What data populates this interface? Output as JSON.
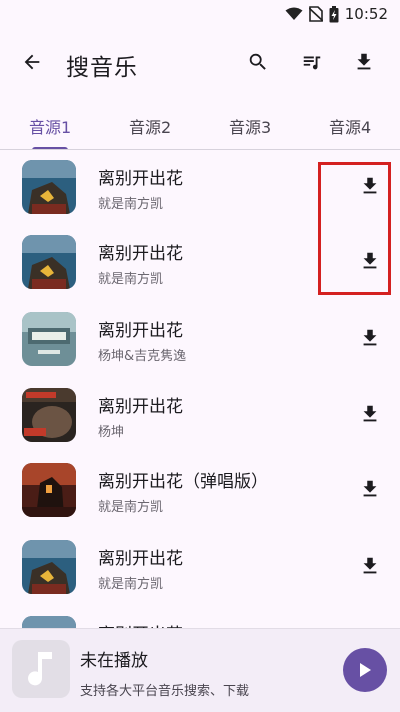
{
  "status_bar": {
    "time": "10:52",
    "icons": [
      "wifi-icon",
      "no-sim-icon",
      "battery-charging-icon"
    ]
  },
  "app_bar": {
    "title": "搜音乐",
    "icons": [
      "back-arrow-icon",
      "search-icon",
      "playlist-icon",
      "download-icon"
    ]
  },
  "tabs": [
    {
      "label": "音源1",
      "active": true
    },
    {
      "label": "音源2",
      "active": false
    },
    {
      "label": "音源3",
      "active": false
    },
    {
      "label": "音源4",
      "active": false
    }
  ],
  "songs": [
    {
      "title": "离别开出花",
      "artist": "就是南方凯"
    },
    {
      "title": "离别开出花",
      "artist": "就是南方凯"
    },
    {
      "title": "离别开出花",
      "artist": "杨坤&吉克隽逸"
    },
    {
      "title": "离别开出花",
      "artist": "杨坤"
    },
    {
      "title": "离别开出花（弹唱版）",
      "artist": "就是南方凯"
    },
    {
      "title": "离别开出花",
      "artist": "就是南方凯"
    },
    {
      "title": "离别开出花",
      "artist": ""
    }
  ],
  "player": {
    "title": "未在播放",
    "subtitle": "支持各大平台音乐搜索、下载"
  },
  "colors": {
    "accent": "#6750a4",
    "highlight": "#d42020"
  }
}
